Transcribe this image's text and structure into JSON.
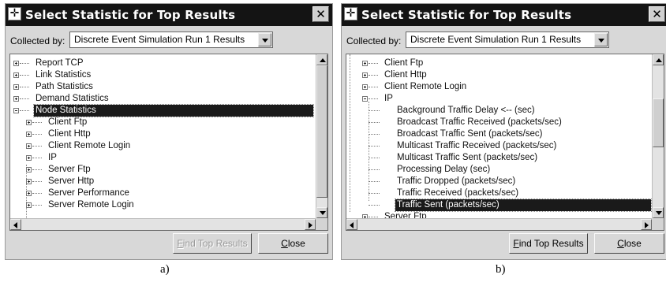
{
  "dialog_a": {
    "title": "Select Statistic for Top Results",
    "collected_label": "Collected by:",
    "collected_value": "Discrete Event Simulation Run 1 Results",
    "find_btn_first": "F",
    "find_btn_rest": "ind Top Results",
    "close_btn_first": "C",
    "close_btn_rest": "lose",
    "items": [
      "Report TCP",
      "Link Statistics",
      "Path Statistics",
      "Demand Statistics",
      "Node Statistics",
      "Client Ftp",
      "Client Http",
      "Client Remote Login",
      "IP",
      "Server Ftp",
      "Server Http",
      "Server Performance",
      "Server Remote Login"
    ]
  },
  "dialog_b": {
    "title": "Select Statistic for Top Results",
    "collected_label": "Collected by:",
    "collected_value": "Discrete Event Simulation Run 1 Results",
    "find_btn_first": "F",
    "find_btn_rest": "ind Top Results",
    "close_btn_first": "C",
    "close_btn_rest": "lose",
    "items": [
      "Client Ftp",
      "Client Http",
      "Client Remote Login",
      "IP",
      "Background Traffic Delay <-- (sec)",
      "Broadcast Traffic Received (packets/sec)",
      "Broadcast Traffic Sent (packets/sec)",
      "Multicast Traffic Received (packets/sec)",
      "Multicast Traffic Sent (packets/sec)",
      "Processing Delay (sec)",
      "Traffic Dropped (packets/sec)",
      "Traffic Received (packets/sec)",
      "Traffic Sent (packets/sec)",
      "Server Ftp"
    ]
  },
  "captions": {
    "a": "a)",
    "b": "b)"
  },
  "icons": {
    "title": "star-cross-icon",
    "close": "close-x-icon",
    "dropdown": "chevron-down-icon",
    "expand": "plus-box-icon",
    "collapse": "minus-box-icon"
  }
}
